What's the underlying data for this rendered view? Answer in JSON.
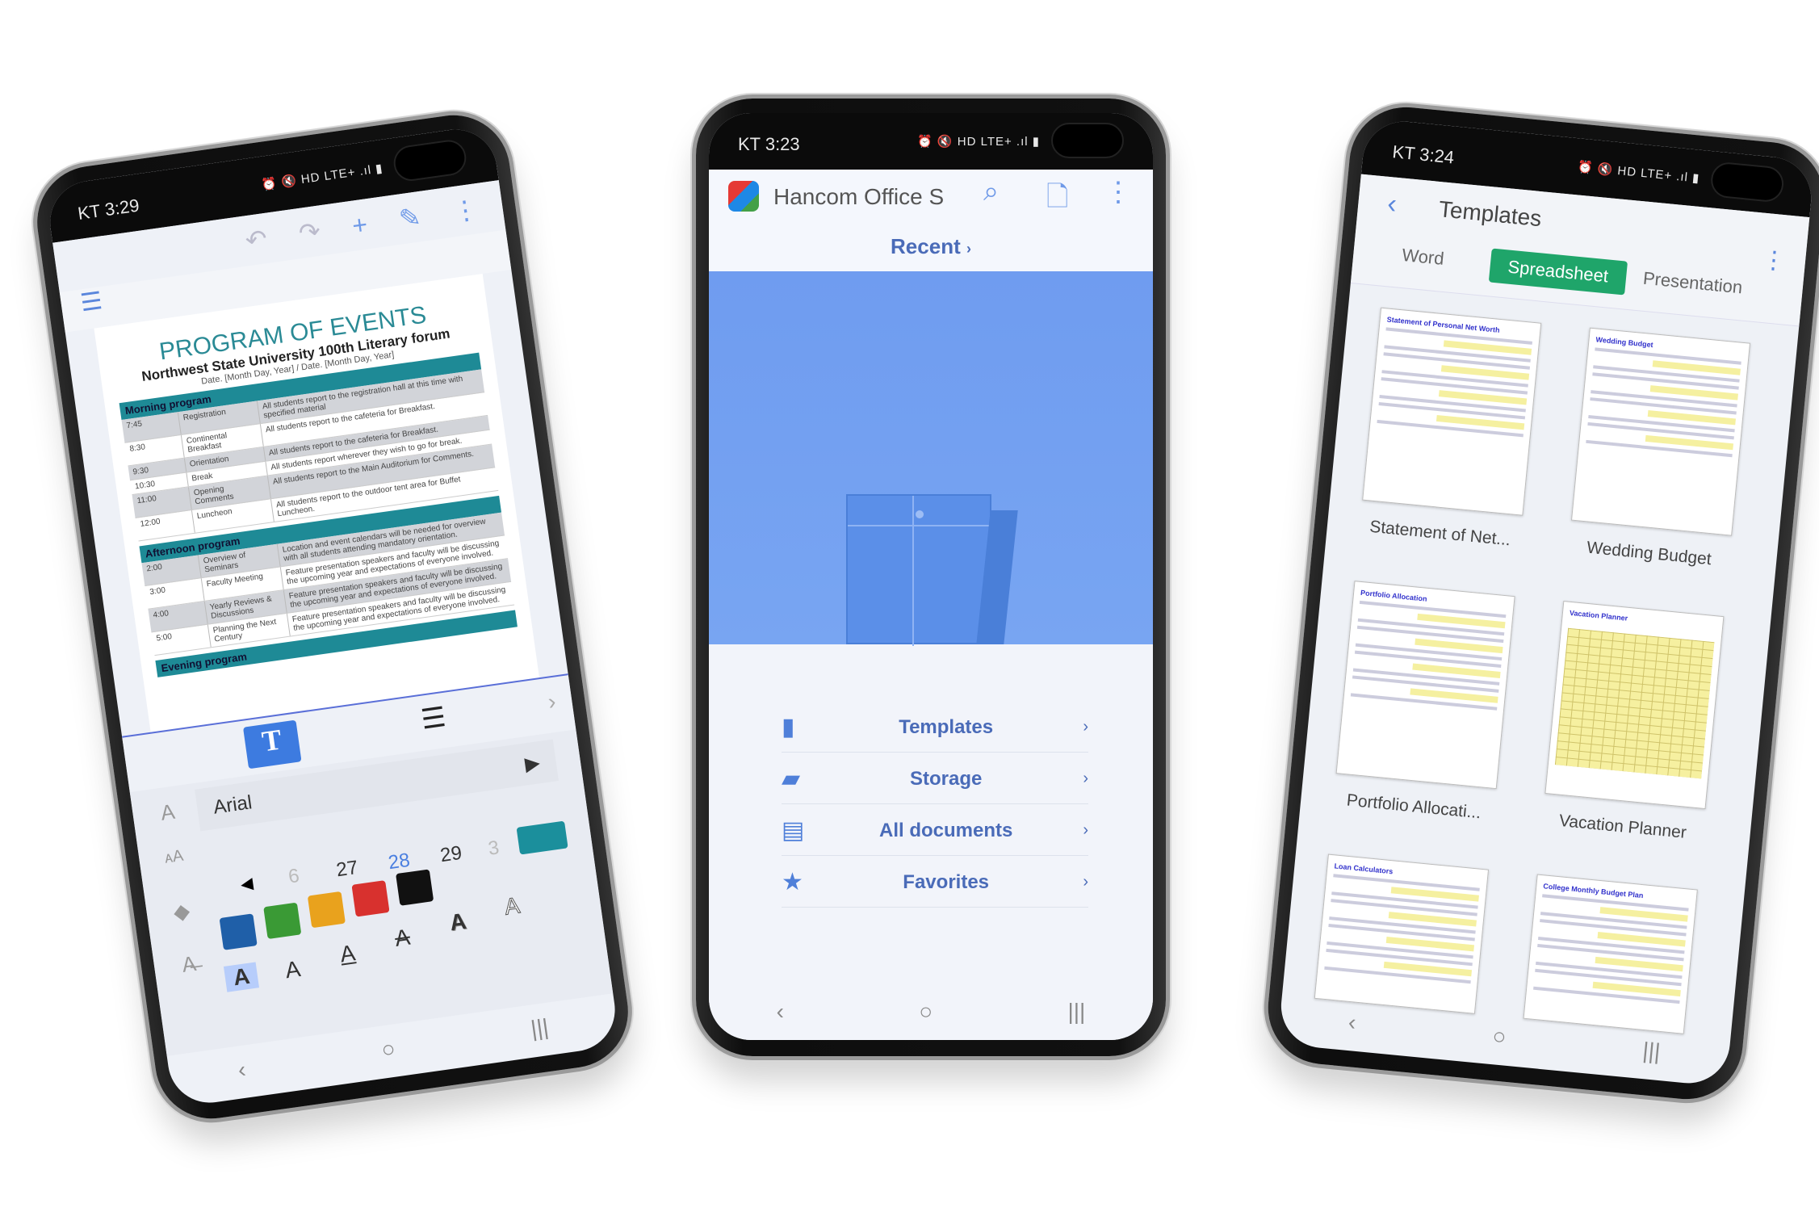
{
  "left_phone": {
    "status_time": "KT 3:29",
    "status_icons": "⏰ 🔇 HD LTE+ .ıl ▮",
    "toolbar": [
      "↶",
      "↷",
      "+",
      "✎",
      "⋮"
    ],
    "doc": {
      "title": "PROGRAM OF EVENTS",
      "subtitle": "Northwest State University 100th Literary forum",
      "date": "Date. [Month Day, Year] / Date. [Month Day, Year]",
      "sections": [
        {
          "name": "Morning program",
          "rows": [
            [
              "7:45",
              "Registration",
              "All students report to the registration hall at this time with specified material"
            ],
            [
              "8:30",
              "Continental Breakfast",
              "All students report to the cafeteria for Breakfast."
            ],
            [
              "9:30",
              "Orientation",
              "All students report to the cafeteria for Breakfast."
            ],
            [
              "10:30",
              "Break",
              "All students report wherever they wish to go for break."
            ],
            [
              "11:00",
              "Opening Comments",
              "All students report to the Main Auditorium for Comments."
            ],
            [
              "12:00",
              "Luncheon",
              "All students report to the outdoor tent area for Buffet Luncheon."
            ]
          ]
        },
        {
          "name": "Afternoon program",
          "rows": [
            [
              "2:00",
              "Overview of Seminars",
              "Location and event calendars will be needed for overview with all students attending mandatory orientation."
            ],
            [
              "3:00",
              "Faculty Meeting",
              "Feature presentation speakers and faculty will be discussing the upcoming year and expectations of everyone involved."
            ],
            [
              "4:00",
              "Yearly Reviews & Discussions",
              "Feature presentation speakers and faculty will be discussing the upcoming year and expectations of everyone involved."
            ],
            [
              "5:00",
              "Planning the Next Century",
              "Feature presentation speakers and faculty will be discussing the upcoming year and expectations of everyone involved."
            ]
          ]
        },
        {
          "name": "Evening program",
          "rows": []
        }
      ]
    },
    "format": {
      "font": "Arial",
      "sizes": [
        "6",
        "27",
        "28",
        "29",
        "3"
      ],
      "selected_size": "28",
      "colors": [
        "#1f5fa8",
        "#3a9a35",
        "#e9a21d",
        "#d8312e",
        "#111111"
      ],
      "current_color": "#1b8f9c",
      "styles": [
        "A",
        "A",
        "A",
        "A",
        "A",
        "A"
      ]
    }
  },
  "center_phone": {
    "status_time": "KT 3:23",
    "status_icons": "⏰ 🔇 HD LTE+ .ıl ▮",
    "app_title": "Hancom Office S",
    "recent": "Recent",
    "menu": [
      {
        "label": "Templates",
        "icon": "template-icon"
      },
      {
        "label": "Storage",
        "icon": "folder-icon"
      },
      {
        "label": "All documents",
        "icon": "documents-icon"
      },
      {
        "label": "Favorites",
        "icon": "star-icon"
      }
    ],
    "accent": "#6f9cf0"
  },
  "right_phone": {
    "status_time": "KT 3:24",
    "status_icons": "⏰ 🔇 HD LTE+ .ıl ▮",
    "title": "Templates",
    "tabs": [
      "Word",
      "Spreadsheet",
      "Presentation"
    ],
    "active_tab": "Spreadsheet",
    "active_color": "#1fa56a",
    "templates": [
      {
        "label": "Statement of Net...",
        "doc_title": "Statement of Personal Net Worth"
      },
      {
        "label": "Wedding Budget",
        "doc_title": "Wedding Budget"
      },
      {
        "label": "Portfolio Allocati...",
        "doc_title": "Portfolio Allocation"
      },
      {
        "label": "Vacation Planner",
        "doc_title": "Vacation Planner"
      },
      {
        "label": "",
        "doc_title": "Loan Calculators"
      },
      {
        "label": "",
        "doc_title": "College Monthly Budget Plan"
      }
    ]
  },
  "nav": [
    "‹",
    "○",
    "|||"
  ]
}
